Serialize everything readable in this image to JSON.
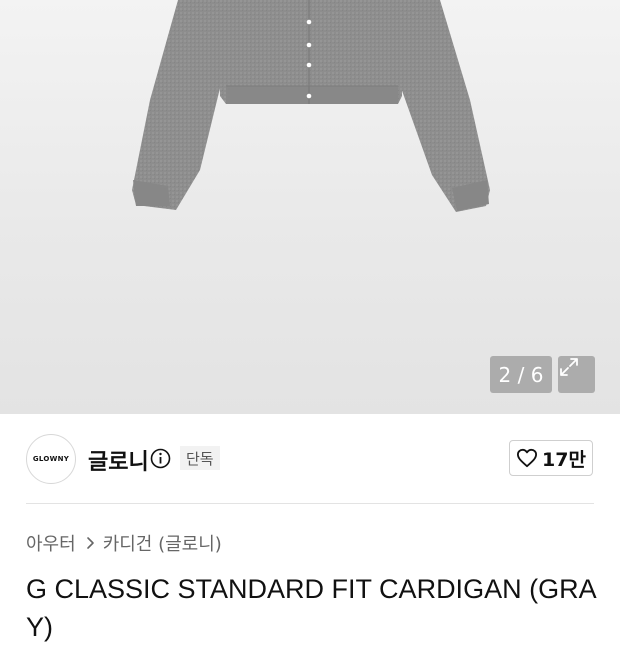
{
  "gallery": {
    "counter": "2 / 6",
    "expand_icon": "expand-icon",
    "image_subject": "gray-cardigan"
  },
  "brand": {
    "logo_text": "GLOWNY",
    "name": "글로니",
    "info_icon": "info-icon",
    "badge": "단독"
  },
  "like": {
    "icon": "heart-icon",
    "count": "17만"
  },
  "breadcrumb": {
    "category": "아우터",
    "separator_icon": "chevron-right-icon",
    "subcategory": "카디건 (글로니)"
  },
  "product": {
    "title": "G CLASSIC STANDARD FIT CARDIGAN (GRAY)"
  },
  "colors": {
    "garment": "#8e8e8e",
    "overlay": "#969696"
  }
}
